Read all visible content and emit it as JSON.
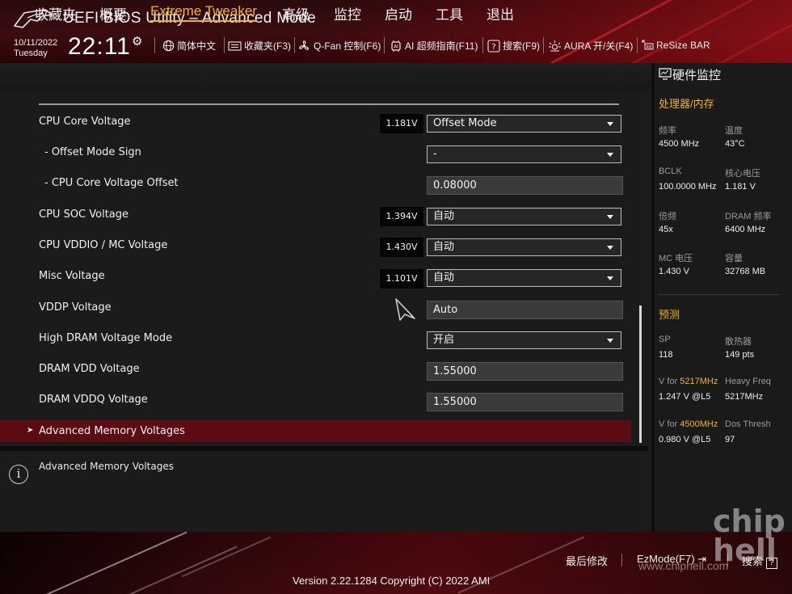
{
  "header": {
    "title": "UEFI BIOS Utility – Advanced Mode",
    "date": "10/11/2022",
    "weekday": "Tuesday",
    "time": "22:11",
    "toolbar": [
      {
        "icon": "globe-icon",
        "label": "简体中文"
      },
      {
        "icon": "bookmark-icon",
        "label": "收藏夹(F3)"
      },
      {
        "icon": "fan-icon",
        "label": "Q-Fan 控制(F6)"
      },
      {
        "icon": "ai-chip-icon",
        "label": "AI 超频指南(F11)"
      },
      {
        "icon": "question-icon",
        "label": "搜索(F9)"
      },
      {
        "icon": "aura-light-icon",
        "label": "AURA 开/关(F4)"
      },
      {
        "icon": "resize-bar-icon",
        "label": "ReSize BAR"
      }
    ]
  },
  "menu": {
    "tabs": [
      "收藏夹",
      "概要",
      "Extreme Tweaker",
      "高级",
      "监控",
      "启动",
      "工具",
      "退出"
    ],
    "active": "Extreme Tweaker"
  },
  "settings": [
    {
      "label": "CPU Core Voltage",
      "current": "1.181V",
      "type": "dropdown",
      "value": "Offset Mode"
    },
    {
      "label": "- Offset Mode Sign",
      "type": "dropdown",
      "value": "-"
    },
    {
      "label": "- CPU Core Voltage Offset",
      "type": "field",
      "value": "0.08000"
    },
    {
      "label": "CPU SOC Voltage",
      "current": "1.394V",
      "type": "dropdown",
      "value": "自动"
    },
    {
      "label": "CPU VDDIO / MC Voltage",
      "current": "1.430V",
      "type": "dropdown",
      "value": "自动"
    },
    {
      "label": "Misc Voltage",
      "current": "1.101V",
      "type": "dropdown",
      "value": "自动"
    },
    {
      "label": "VDDP Voltage",
      "type": "field",
      "value": "Auto"
    },
    {
      "label": "High DRAM Voltage Mode",
      "type": "dropdown",
      "value": "开启"
    },
    {
      "label": "DRAM VDD Voltage",
      "type": "field",
      "value": "1.55000"
    },
    {
      "label": "DRAM VDDQ Voltage",
      "type": "field",
      "value": "1.55000"
    }
  ],
  "submenu": {
    "label": "Advanced Memory Voltages"
  },
  "help": {
    "text": "Advanced Memory Voltages"
  },
  "hw_monitor": {
    "title": "硬件监控",
    "cpu_mem": {
      "title": "处理器/内存",
      "items": [
        {
          "k": "频率",
          "v": "4500 MHz"
        },
        {
          "k": "温度",
          "v": "43°C"
        },
        {
          "k": "BCLK",
          "v": "100.0000 MHz"
        },
        {
          "k": "核心电压",
          "v": "1.181 V"
        },
        {
          "k": "倍频",
          "v": "45x"
        },
        {
          "k": "DRAM 频率",
          "v": "6400 MHz"
        },
        {
          "k": "MC 电压",
          "v": "1.430 V"
        },
        {
          "k": "容量",
          "v": "32768 MB"
        }
      ]
    },
    "prediction": {
      "title": "预测",
      "sp_label": "SP",
      "sp_value": "118",
      "cooler_label": "散热器",
      "cooler_value": "149 pts",
      "v_for_prefix": "V for ",
      "heavy_freq_mhz": "5217MHz",
      "heavy_voltage": "1.247 V @L5",
      "heavy_label": "Heavy Freq",
      "heavy_value": "5217MHz",
      "dos_freq_mhz": "4500MHz",
      "dos_voltage": "0.980 V @L5",
      "dos_label": "Dos Thresh",
      "dos_value": "97"
    }
  },
  "footer": {
    "last_modified": "最后修改",
    "ezmode": "EzMode(F7)",
    "search": "搜索",
    "version": "Version 2.22.1284 Copyright (C) 2022 AMI",
    "watermark_url": "www.chiphell.com"
  },
  "colors": {
    "accent": "#f5b31b",
    "selected_row": "#5c0b12",
    "header_red": "#3b0c10"
  }
}
